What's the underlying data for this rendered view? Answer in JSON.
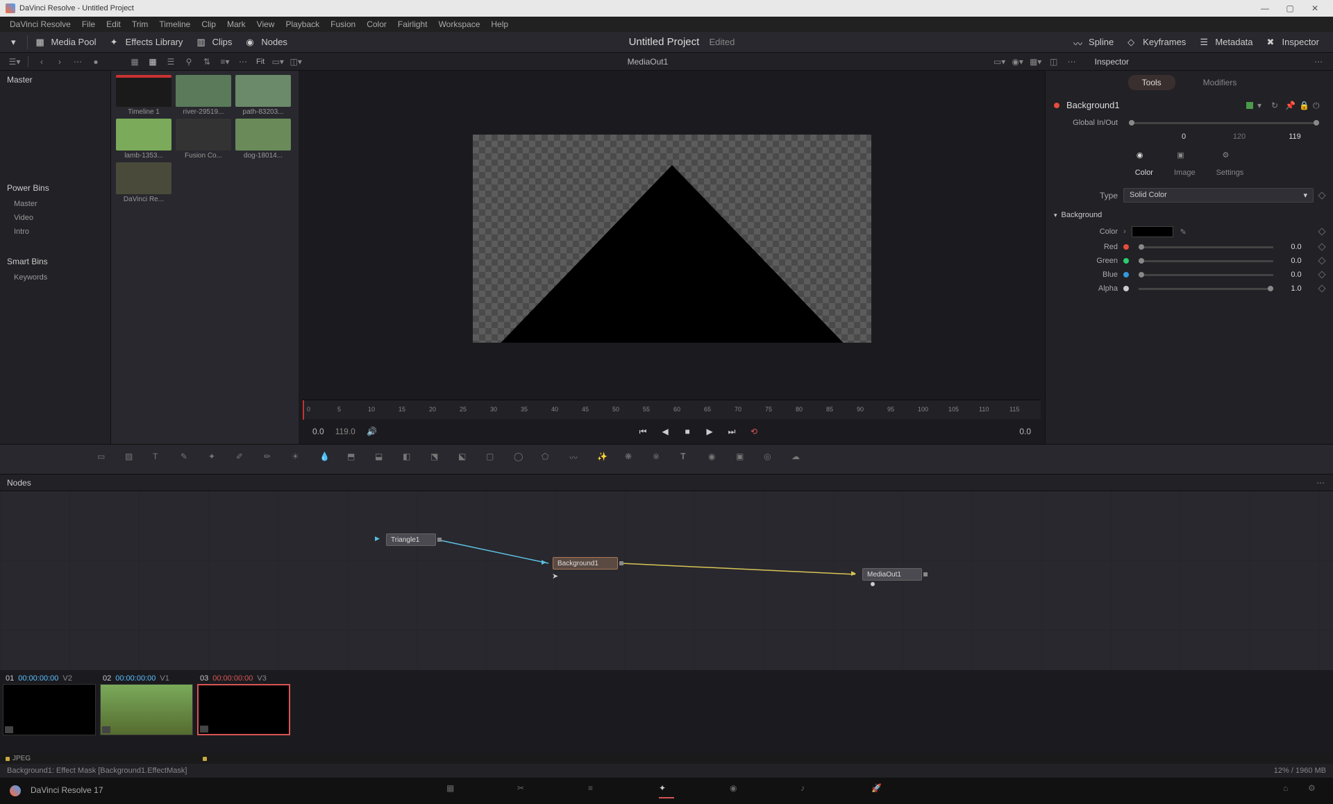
{
  "title": "DaVinci Resolve - Untitled Project",
  "menus": [
    "DaVinci Resolve",
    "File",
    "Edit",
    "Trim",
    "Timeline",
    "Clip",
    "Mark",
    "View",
    "Playback",
    "Fusion",
    "Color",
    "Fairlight",
    "Workspace",
    "Help"
  ],
  "toolbar": {
    "mediapool": "Media Pool",
    "effects": "Effects Library",
    "clips": "Clips",
    "nodes": "Nodes",
    "spline": "Spline",
    "keyframes": "Keyframes",
    "metadata": "Metadata",
    "inspector": "Inspector",
    "project": "Untitled Project",
    "edited": "Edited"
  },
  "subtool": {
    "fit": "Fit",
    "viewer_label": "MediaOut1"
  },
  "left": {
    "master": "Master",
    "powerbins": "Power Bins",
    "bins": [
      "Master",
      "Video",
      "Intro"
    ],
    "smartbins": "Smart Bins",
    "keywords": "Keywords"
  },
  "clips": [
    {
      "name": "Timeline 1",
      "bg": "#1a1a1a",
      "stripe": "#c83232"
    },
    {
      "name": "river-29519...",
      "bg": "#5a7a5a"
    },
    {
      "name": "path-83203...",
      "bg": "#6a8a6a"
    },
    {
      "name": "lamb-1353...",
      "bg": "#7aaa5a"
    },
    {
      "name": "Fusion Co...",
      "bg": "#333"
    },
    {
      "name": "dog-18014...",
      "bg": "#6a8a5a"
    },
    {
      "name": "DaVinci Re...",
      "bg": "#4a4a3a"
    }
  ],
  "ruler_ticks": [
    "0",
    "5",
    "10",
    "15",
    "20",
    "25",
    "30",
    "35",
    "40",
    "45",
    "50",
    "55",
    "60",
    "65",
    "70",
    "75",
    "80",
    "85",
    "90",
    "95",
    "100",
    "105",
    "110",
    "115"
  ],
  "play": {
    "start": "0.0",
    "end": "119.0",
    "right": "0.0"
  },
  "inspector": {
    "title": "Inspector",
    "tabs": {
      "tools": "Tools",
      "modifiers": "Modifiers"
    },
    "node": "Background1",
    "global": "Global In/Out",
    "g0": "0",
    "g1": "120",
    "g2": "119",
    "modes": {
      "color": "Color",
      "image": "Image",
      "settings": "Settings"
    },
    "type_lbl": "Type",
    "type_val": "Solid Color",
    "section": "Background",
    "color": "Color",
    "red": "Red",
    "green": "Green",
    "blue": "Blue",
    "alpha": "Alpha",
    "zero": "0.0",
    "one": "1.0"
  },
  "nodes": {
    "title": "Nodes",
    "triangle": "Triangle1",
    "background": "Background1",
    "mediaout": "MediaOut1"
  },
  "bclips": [
    {
      "num": "01",
      "tc": "00:00:00:00",
      "trk": "V2",
      "red": false,
      "bg": "#000"
    },
    {
      "num": "02",
      "tc": "00:00:00:00",
      "trk": "V1",
      "red": false,
      "bg": "linear-gradient(#7aaa5a,#556b2f)"
    },
    {
      "num": "03",
      "tc": "00:00:00:00",
      "trk": "V3",
      "red": true,
      "bg": "#000"
    }
  ],
  "jpeg": "JPEG",
  "status": {
    "left": "Background1: Effect Mask    [Background1.EffectMask]",
    "right": "12% / 1960 MB"
  },
  "app": "DaVinci Resolve 17"
}
